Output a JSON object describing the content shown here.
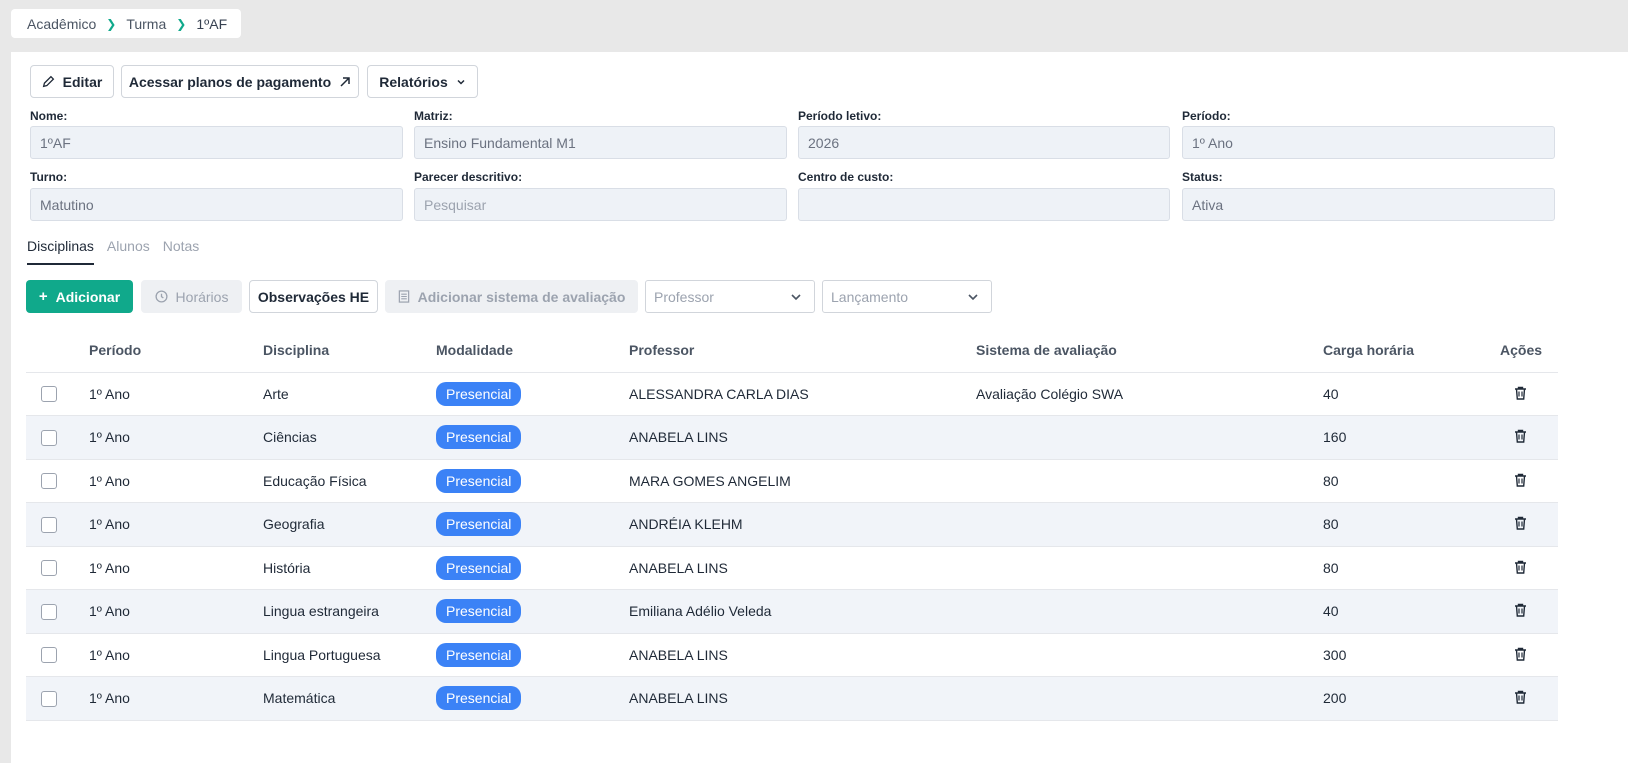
{
  "breadcrumb": {
    "items": [
      "Acadêmico",
      "Turma",
      "1ºAF"
    ]
  },
  "toolbar": {
    "edit_label": "Editar",
    "payment_plans_label": "Acessar planos de pagamento",
    "reports_label": "Relatórios"
  },
  "form": {
    "nome": {
      "label": "Nome:",
      "value": "1ºAF"
    },
    "matriz": {
      "label": "Matriz:",
      "value": "Ensino Fundamental M1"
    },
    "periodo_letivo": {
      "label": "Período letivo:",
      "value": "2026"
    },
    "periodo": {
      "label": "Período:",
      "value": "1º Ano"
    },
    "turno": {
      "label": "Turno:",
      "value": "Matutino"
    },
    "parecer": {
      "label": "Parecer descritivo:",
      "placeholder": "Pesquisar"
    },
    "centro_custo": {
      "label": "Centro de custo:",
      "value": ""
    },
    "status": {
      "label": "Status:",
      "value": "Ativa"
    }
  },
  "tabs": [
    "Disciplinas",
    "Alunos",
    "Notas"
  ],
  "actions": {
    "add_label": "Adicionar",
    "schedules_label": "Horários",
    "observations_label": "Observações HE",
    "add_evaluation_label": "Adicionar sistema de avaliação",
    "professor_placeholder": "Professor",
    "launch_placeholder": "Lançamento"
  },
  "table": {
    "headers": [
      "Período",
      "Disciplina",
      "Modalidade",
      "Professor",
      "Sistema de avaliação",
      "Carga horária",
      "Ações"
    ],
    "rows": [
      {
        "periodo": "1º Ano",
        "disciplina": "Arte",
        "modalidade": "Presencial",
        "professor": "ALESSANDRA CARLA DIAS",
        "sistema": "Avaliação Colégio SWA",
        "carga": "40"
      },
      {
        "periodo": "1º Ano",
        "disciplina": "Ciências",
        "modalidade": "Presencial",
        "professor": "ANABELA LINS",
        "sistema": "",
        "carga": "160"
      },
      {
        "periodo": "1º Ano",
        "disciplina": "Educação Física",
        "modalidade": "Presencial",
        "professor": "MARA GOMES ANGELIM",
        "sistema": "",
        "carga": "80"
      },
      {
        "periodo": "1º Ano",
        "disciplina": "Geografia",
        "modalidade": "Presencial",
        "professor": "ANDRÉIA KLEHM",
        "sistema": "",
        "carga": "80"
      },
      {
        "periodo": "1º Ano",
        "disciplina": "História",
        "modalidade": "Presencial",
        "professor": "ANABELA LINS",
        "sistema": "",
        "carga": "80"
      },
      {
        "periodo": "1º Ano",
        "disciplina": "Lingua estrangeira",
        "modalidade": "Presencial",
        "professor": "Emiliana Adélio Veleda",
        "sistema": "",
        "carga": "40"
      },
      {
        "periodo": "1º Ano",
        "disciplina": "Lingua Portuguesa",
        "modalidade": "Presencial",
        "professor": "ANABELA LINS",
        "sistema": "",
        "carga": "300"
      },
      {
        "periodo": "1º Ano",
        "disciplina": "Matemática",
        "modalidade": "Presencial",
        "professor": "ANABELA LINS",
        "sistema": "",
        "carga": "200"
      }
    ]
  }
}
